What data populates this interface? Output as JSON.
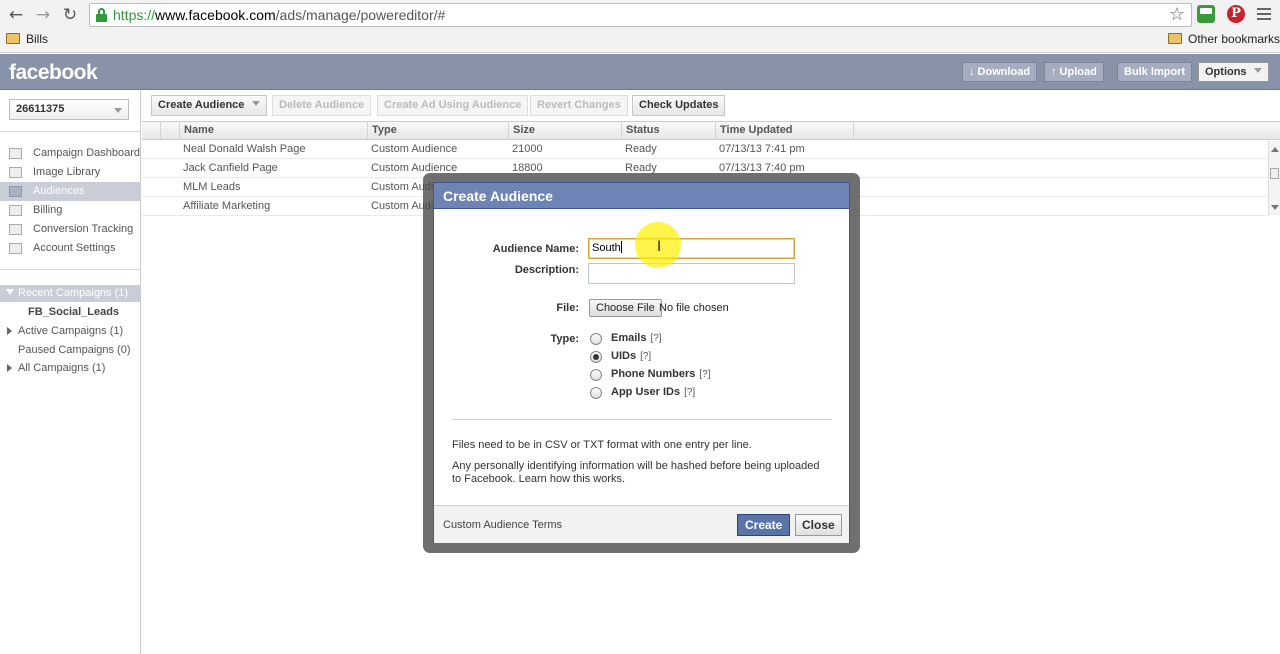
{
  "browser": {
    "url_scheme": "https://",
    "url_host": "www.facebook.com",
    "url_path": "/ads/manage/poweredit​or/#",
    "bookmarks": [
      "Bills"
    ],
    "other_bookmarks": "Other bookmarks",
    "extension_pinterest": "P"
  },
  "header": {
    "logo": "facebook",
    "download": "↓ Download",
    "upload": "↑ Upload",
    "bulk_import": "Bulk Import",
    "options": "Options"
  },
  "sidebar": {
    "account_id": "26611375",
    "nav": [
      {
        "label": "Campaign Dashboard",
        "active": false
      },
      {
        "label": "Image Library",
        "active": false
      },
      {
        "label": "Audiences",
        "active": true
      },
      {
        "label": "Billing",
        "active": false
      },
      {
        "label": "Conversion Tracking",
        "active": false
      },
      {
        "label": "Account Settings",
        "active": false
      }
    ],
    "recent_campaigns": "Recent Campaigns (1)",
    "recent_item": "FB_Social_Leads",
    "active_campaigns": "Active Campaigns (1)",
    "paused_campaigns": "Paused Campaigns (0)",
    "all_campaigns": "All Campaigns (1)"
  },
  "toolbar": {
    "create_audience": "Create Audience",
    "delete_audience": "Delete Audience",
    "create_ad": "Create Ad Using Audience",
    "revert": "Revert Changes",
    "check_updates": "Check Updates"
  },
  "table": {
    "columns": [
      "Name",
      "Type",
      "Size",
      "Status",
      "Time Updated"
    ],
    "rows": [
      [
        "Neal Donald Walsh Page",
        "Custom Audience",
        "21000",
        "Ready",
        "07/13/13 7:41 pm"
      ],
      [
        "Jack Canfield Page",
        "Custom Audience",
        "18800",
        "Ready",
        "07/13/13 7:40 pm"
      ],
      [
        "MLM Leads",
        "Custom Audience",
        "",
        "",
        ""
      ],
      [
        "Affiliate Marketing",
        "Custom Audience",
        "",
        "",
        ""
      ]
    ]
  },
  "dialog": {
    "title": "Create Audience",
    "name_label": "Audience Name:",
    "name_value": "South",
    "description_label": "Description:",
    "description_value": "",
    "file_label": "File:",
    "choose_file": "Choose File",
    "no_file": "No file chosen",
    "type_label": "Type:",
    "types": [
      {
        "label": "Emails",
        "checked": false
      },
      {
        "label": "UIDs",
        "checked": true
      },
      {
        "label": "Phone Numbers",
        "checked": false
      },
      {
        "label": "App User IDs",
        "checked": false
      }
    ],
    "help": "[?]",
    "note1": "Files need to be in CSV or TXT format with one entry per line.",
    "note2": "Any personally identifying information will be hashed before being uploaded to Facebook. Learn how this works.",
    "terms": "Custom Audience Terms",
    "create": "Create",
    "close": "Close"
  }
}
